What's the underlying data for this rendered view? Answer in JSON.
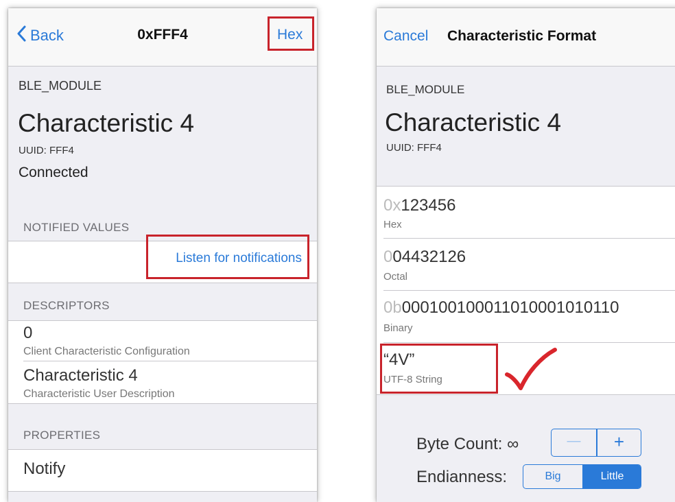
{
  "left": {
    "nav": {
      "back_label": "Back",
      "title": "0xFFF4",
      "hex_label": "Hex"
    },
    "peripheral_name": "BLE_MODULE",
    "characteristic_title": "Characteristic 4",
    "uuid": "UUID: FFF4",
    "status": "Connected",
    "notified_values": {
      "header": "NOTIFIED VALUES",
      "listen_label": "Listen for notifications"
    },
    "descriptors": {
      "header": "DESCRIPTORS",
      "items": [
        {
          "value": "0",
          "label": "Client Characteristic Configuration"
        },
        {
          "value": "Characteristic 4",
          "label": "Characteristic User Description"
        }
      ]
    },
    "properties": {
      "header": "PROPERTIES",
      "items": [
        "Notify"
      ]
    }
  },
  "right": {
    "nav": {
      "cancel_label": "Cancel",
      "title": "Characteristic Format"
    },
    "peripheral_name": "BLE_MODULE",
    "characteristic_title": "Characteristic 4",
    "uuid": "UUID: FFF4",
    "formats": [
      {
        "prefix": "0x",
        "value": "123456",
        "label": "Hex",
        "selected": true
      },
      {
        "prefix": "0",
        "value": "04432126",
        "label": "Octal",
        "selected": false
      },
      {
        "prefix": "0b",
        "value": "000100100011010001010110",
        "label": "Binary",
        "selected": false
      },
      {
        "prefix": "",
        "value": "“4V”",
        "label": "UTF-8 String",
        "selected": false
      }
    ],
    "checkmark": "✓",
    "byte_count": {
      "label": "Byte Count: ∞",
      "minus": "—",
      "plus": "+"
    },
    "endianness": {
      "label": "Endianness:",
      "options": [
        "Big",
        "Little"
      ],
      "selected": "Little"
    }
  },
  "colors": {
    "accent": "#2a7ad8",
    "highlight_box": "#c8232b",
    "annotation_check": "#d9262c"
  }
}
